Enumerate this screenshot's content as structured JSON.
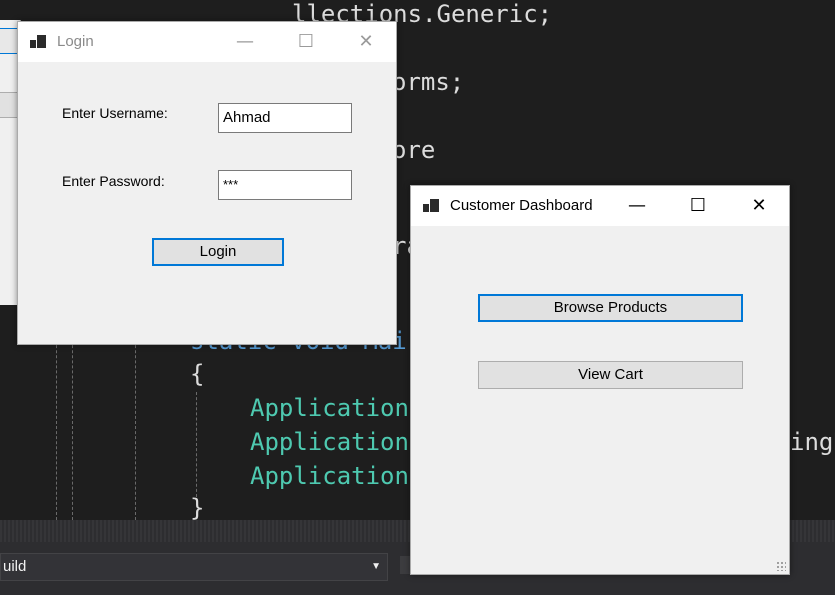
{
  "editor": {
    "lines": [
      {
        "text": "llections.Generic;",
        "color": "white"
      },
      {
        "text": "orms;",
        "color": "white"
      },
      {
        "text": "ore",
        "color": "white"
      },
      {
        "text": "ra",
        "color": "white"
      },
      {
        "text": "static void Mai",
        "color": "blue"
      },
      {
        "text": "{",
        "color": "white"
      },
      {
        "text": "Application",
        "color": "teal"
      },
      {
        "text": "Application",
        "color": "teal"
      },
      {
        "text": "ingD",
        "color": "white"
      },
      {
        "text": "Application",
        "color": "teal"
      },
      {
        "text": "}",
        "color": "white"
      }
    ],
    "build_dropdown": "uild"
  },
  "login_window": {
    "title": "Login",
    "minimize": "—",
    "maximize": "☐",
    "close": "✕",
    "username_label": "Enter Username:",
    "username_value": "Ahmad",
    "password_label": "Enter Password:",
    "password_value": "***",
    "login_button": "Login"
  },
  "dashboard_window": {
    "title": "Customer Dashboard",
    "minimize": "—",
    "maximize": "☐",
    "close": "✕",
    "browse_button": "Browse Products",
    "cart_button": "View Cart"
  },
  "colors": {
    "editor_bg": "#1e1e1e",
    "code_teal": "#4ec9b0",
    "code_blue": "#569cd6",
    "form_bg": "#f0f0f0",
    "focus_blue": "#0078d7"
  }
}
